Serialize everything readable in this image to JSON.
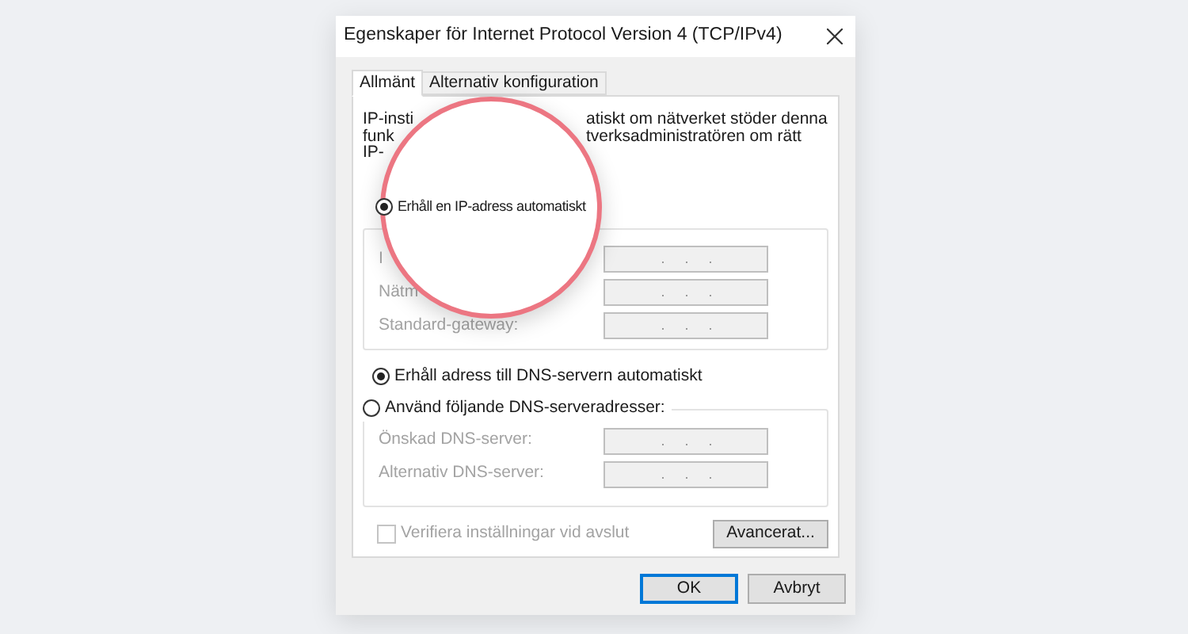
{
  "window": {
    "title": "Egenskaper för Internet Protocol Version 4 (TCP/IPv4)"
  },
  "tabs": [
    {
      "label": "Allmänt",
      "selected": true
    },
    {
      "label": "Alternativ konfiguration",
      "selected": false
    }
  ],
  "intro_lines": [
    {
      "left": "IP-insti",
      "right": "atiskt om nätverket stöder denna"
    },
    {
      "left": "funk",
      "right": "tverksadministratören om rätt"
    },
    {
      "left": "IP-"
    }
  ],
  "ip_mode": [
    {
      "label": "Erhåll en IP-adress automatiskt",
      "selected": true
    }
  ],
  "ip_fields": [
    {
      "label": "I",
      "disabled": true
    },
    {
      "label": "Nätm",
      "disabled": true
    },
    {
      "label": "Standard-gateway:",
      "disabled": true
    }
  ],
  "dns_mode": [
    {
      "label": "Erhåll adress till DNS-servern automatiskt",
      "selected": true
    },
    {
      "label": "Använd följande DNS-serveradresser:",
      "selected": false
    }
  ],
  "dns_fields": [
    {
      "label": "Önskad DNS-server:",
      "disabled": true
    },
    {
      "label": "Alternativ DNS-server:",
      "disabled": true
    }
  ],
  "verify": {
    "label": "Verifiera inställningar vid avslut",
    "checked": false,
    "disabled": true
  },
  "advanced_button": "Avancerat...",
  "buttons": [
    {
      "label": "OK",
      "default": true
    },
    {
      "label": "Avbryt",
      "default": false
    }
  ]
}
